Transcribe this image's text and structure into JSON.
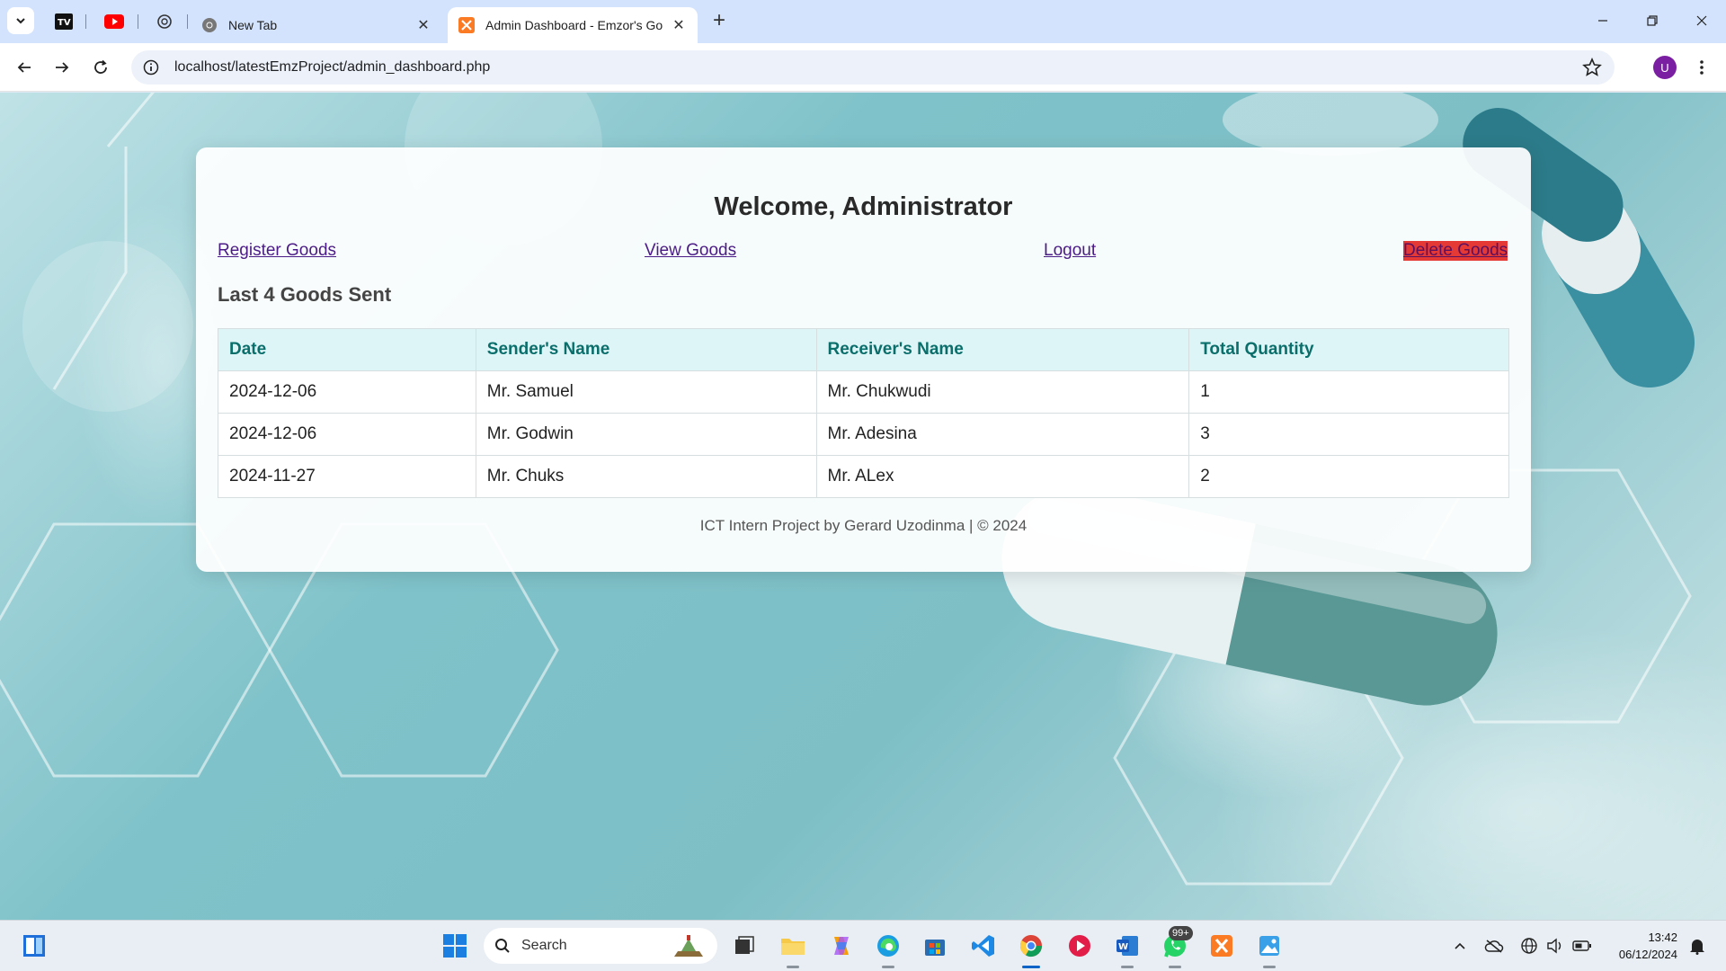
{
  "browser": {
    "tabs": [
      {
        "title": "New Tab",
        "active": false
      },
      {
        "title": "Admin Dashboard - Emzor's Go",
        "active": true
      }
    ],
    "url": "localhost/latestEmzProject/admin_dashboard.php",
    "profile_initial": "U"
  },
  "page": {
    "welcome": "Welcome, Administrator",
    "nav": {
      "register": "Register Goods",
      "view": "View Goods",
      "logout": "Logout",
      "delete": "Delete Goods"
    },
    "section_title": "Last 4 Goods Sent",
    "table": {
      "headers": [
        "Date",
        "Sender's Name",
        "Receiver's Name",
        "Total Quantity"
      ],
      "rows": [
        [
          "2024-12-06",
          "Mr. Samuel",
          "Mr. Chukwudi",
          "1"
        ],
        [
          "2024-12-06",
          "Mr. Godwin",
          "Mr. Adesina",
          "3"
        ],
        [
          "2024-11-27",
          "Mr. Chuks",
          "Mr. ALex",
          "2"
        ]
      ]
    },
    "footer": "ICT Intern Project by Gerard Uzodinma | © 2024"
  },
  "taskbar": {
    "search_label": "Search",
    "whatsapp_badge": "99+",
    "time": "13:42",
    "date": "06/12/2024"
  },
  "colors": {
    "accent_teal": "#0a6e6b",
    "delete_bg": "#e53935",
    "link": "#4b1c86"
  }
}
